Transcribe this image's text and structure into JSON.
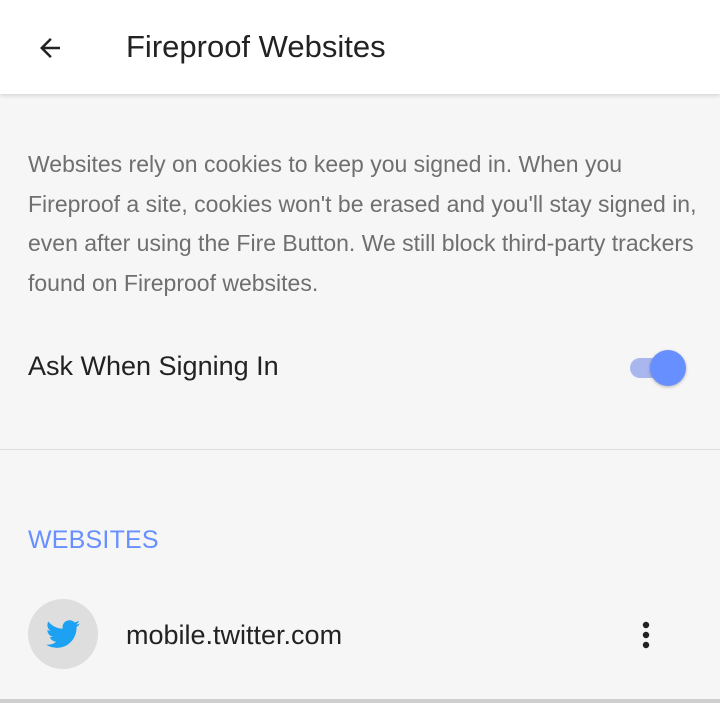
{
  "app_bar": {
    "title": "Fireproof Websites",
    "back_icon": "arrow-back-icon"
  },
  "description": "Websites rely on cookies to keep you signed in. When you Fireproof a site, cookies won't be erased and you'll stay signed in, even after using the Fire Button. We still block third-party trackers found on Fireproof websites.",
  "setting": {
    "label": "Ask When Signing In",
    "enabled": true
  },
  "websites_section": {
    "header": "WEBSITES",
    "items": [
      {
        "domain": "mobile.twitter.com",
        "icon": "twitter-bird-icon",
        "menu_icon": "more-vertical-icon"
      }
    ]
  },
  "colors": {
    "accent": "#678fff",
    "switch_track": "#aab7ef",
    "twitter_blue": "#1da1f2",
    "background": "#f6f6f6",
    "description_text": "#6f6f6f"
  }
}
